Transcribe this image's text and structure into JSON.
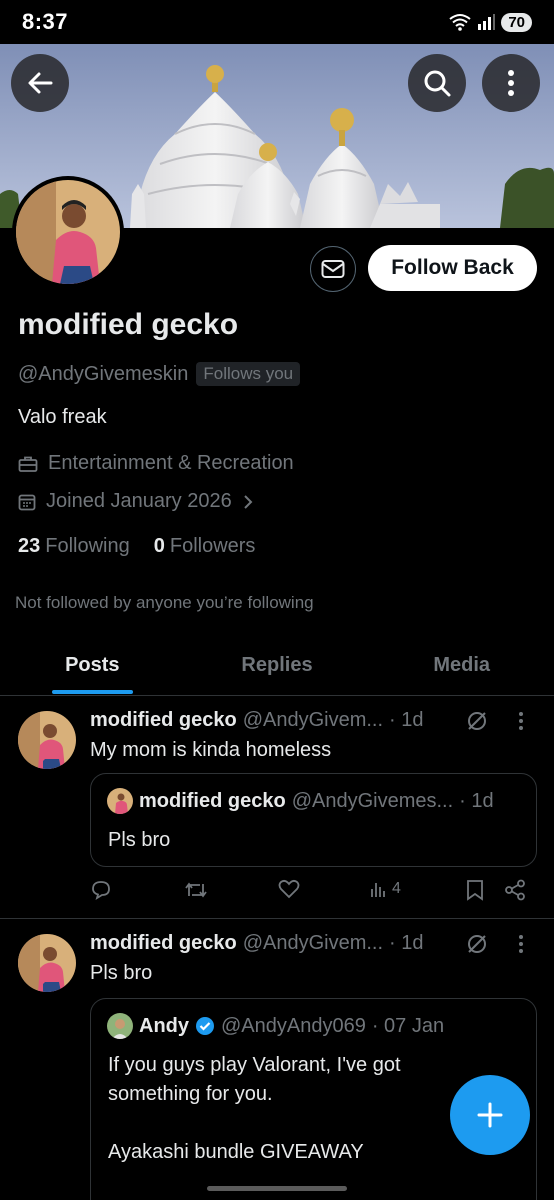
{
  "status_bar": {
    "time": "8:37",
    "battery": "70"
  },
  "header": {
    "back_icon": "arrow-left-icon",
    "search_icon": "search-icon",
    "more_icon": "more-vertical-icon"
  },
  "profile": {
    "name": "modified gecko",
    "handle": "@AndyGivemeskin",
    "follows_you": "Follows you",
    "bio": "Valo freak",
    "category": "Entertainment & Recreation",
    "joined": "Joined January 2026",
    "following_count": "23",
    "following_label": "Following",
    "followers_count": "0",
    "followers_label": "Followers",
    "not_followed": "Not followed by anyone you’re following",
    "follow_button": "Follow Back"
  },
  "tabs": [
    {
      "label": "Posts",
      "active": true
    },
    {
      "label": "Replies",
      "active": false
    },
    {
      "label": "Media",
      "active": false
    }
  ],
  "posts": [
    {
      "name": "modified gecko",
      "handle": "@AndyGivem...",
      "time": "· 1d",
      "text": "My mom is kinda homeless",
      "quote": {
        "name": "modified gecko",
        "handle": "@AndyGivemes...",
        "time": "· 1d",
        "text": "Pls bro"
      },
      "views": "4"
    },
    {
      "name": "modified gecko",
      "handle": "@AndyGivem...",
      "time": "· 1d",
      "text": "Pls bro",
      "quote": {
        "name": "Andy",
        "handle": "@AndyAndy069",
        "time": "· 07 Jan",
        "text_line1": "If you guys play Valorant, I've got",
        "text_line2": "something for you.",
        "text_line3": "Ayakashi bundle GIVEAWAY"
      }
    }
  ],
  "colors": {
    "accent": "#1d9bf0",
    "background": "#000000",
    "text_primary": "#e7e9ea",
    "text_secondary": "#71767b",
    "border": "#2f3336"
  }
}
